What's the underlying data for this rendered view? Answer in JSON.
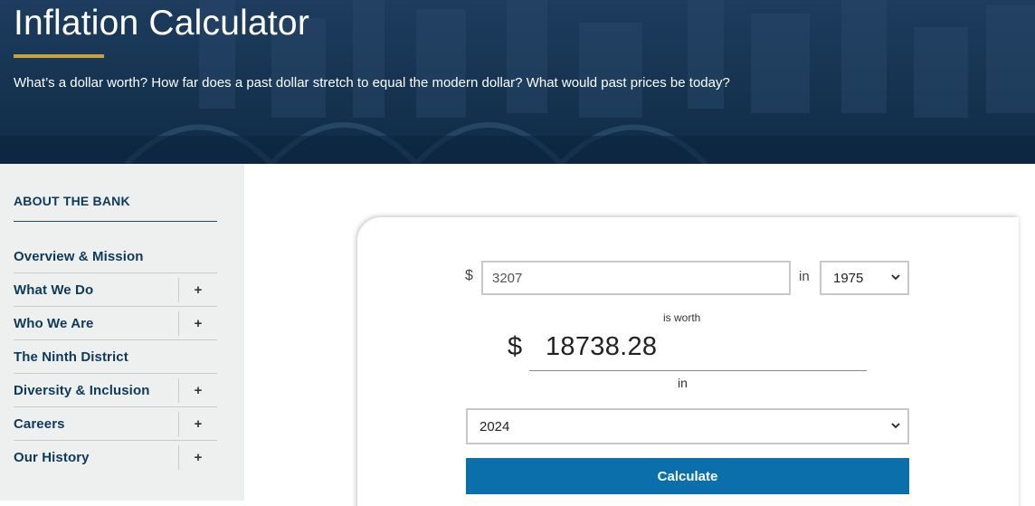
{
  "hero": {
    "title": "Inflation Calculator",
    "subtitle": "What’s a dollar worth? How far does a past dollar stretch to equal the modern dollar? What would past prices be today?",
    "accent_color": "#c8a23c"
  },
  "sidebar": {
    "heading": "ABOUT THE BANK",
    "items": [
      {
        "label": "Overview & Mission",
        "expandable": false
      },
      {
        "label": "What We Do",
        "expandable": true,
        "toggle": "+"
      },
      {
        "label": "Who We Are",
        "expandable": true,
        "toggle": "+"
      },
      {
        "label": "The Ninth District",
        "expandable": false
      },
      {
        "label": "Diversity & Inclusion",
        "expandable": true,
        "toggle": "+"
      },
      {
        "label": "Careers",
        "expandable": true,
        "toggle": "+"
      },
      {
        "label": "Our History",
        "expandable": true,
        "toggle": "+"
      }
    ]
  },
  "calculator": {
    "currency_symbol": "$",
    "amount_value": "3207",
    "in_label": "in",
    "from_year": "1975",
    "is_worth_label": "is worth",
    "result_symbol": "$",
    "result_value": "18738.28",
    "in_label_2": "in",
    "to_year": "2024",
    "calculate_label": "Calculate",
    "button_color": "#0b6fac"
  }
}
